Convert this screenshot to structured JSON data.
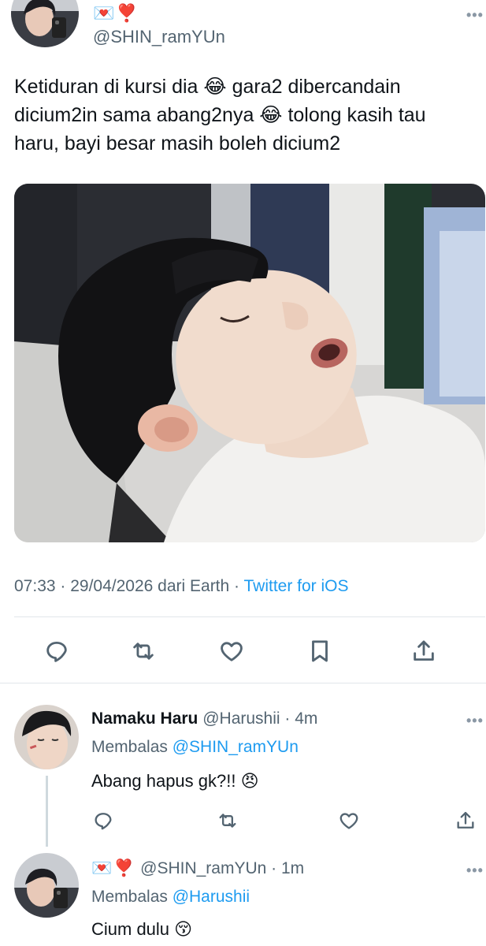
{
  "main_tweet": {
    "display_name_emoji": "💌❣️",
    "handle": "@SHIN_ramYUn",
    "text_lines": [
      "Ketiduran di kursi dia 😂 gara2 dibercandain",
      "dicium2in sama abang2nya 😂 tolong kasih tau",
      "haru, bayi besar masih boleh dicium2"
    ],
    "timestamp": "07:33 · 29/04/2026 dari Earth · ",
    "source": "Twitter for iOS",
    "more_icon": "more-horizontal-icon"
  },
  "actions": {
    "reply_icon": "reply-icon",
    "retweet_icon": "retweet-icon",
    "like_icon": "heart-icon",
    "bookmark_icon": "bookmark-icon",
    "share_icon": "share-icon"
  },
  "replies": [
    {
      "name": "Namaku Haru",
      "handle_time": " @Harushii · 4m",
      "replying_prefix": "Membalas ",
      "replying_to": "@SHIN_ramYUn",
      "text": "Abang hapus gk?!! 😠"
    },
    {
      "name_emoji": "💌❣️",
      "handle_time": " @SHIN_ramYUn · 1m",
      "replying_prefix": "Membalas ",
      "replying_to": "@Harushii",
      "text": "Cium dulu 😚"
    }
  ],
  "colors": {
    "link_blue": "#1d9bf0",
    "secondary_text": "#536471",
    "divider": "#e1e6ea"
  }
}
